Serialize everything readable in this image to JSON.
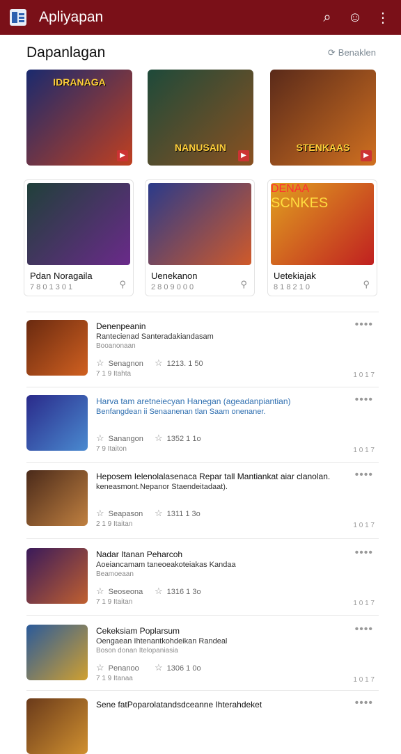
{
  "appbar": {
    "title": "Apliyapan",
    "icons": [
      "menu-logo-icon",
      "search-icon",
      "voice-search-icon",
      "more-vert-icon"
    ]
  },
  "featured": {
    "title": "Dapanlagan",
    "see_all": "Benaklen",
    "tiles": [
      {
        "label": "IDRANAGA",
        "position": "top",
        "colors": [
          "#1a2a6e",
          "#c04020"
        ]
      },
      {
        "label": "NANUSAIN",
        "position": "bottom",
        "colors": [
          "#1e4a3a",
          "#8a5020"
        ]
      },
      {
        "label": "STENKAAS",
        "position": "bottom",
        "colors": [
          "#5a2a1a",
          "#d07020"
        ]
      }
    ],
    "cards": [
      {
        "name": "Pdan Noragaila",
        "meta": "7 8 0 1 3 0 1",
        "colors": [
          "#20403a",
          "#6a2a8a"
        ]
      },
      {
        "name": "Uenekanon",
        "meta": "2 8 0 9 0 0 0",
        "colors": [
          "#2a3a8a",
          "#d05a2a"
        ]
      },
      {
        "name": "Uetekiajak",
        "meta": "8 1 8 2 1 0",
        "colors": [
          "#e0a020",
          "#c02020"
        ],
        "art_label": "SCNKES",
        "art_top": "DENAA"
      }
    ]
  },
  "list": [
    {
      "title": "Denenpeanin",
      "desc": "Rantecienad Santeradakiandasam",
      "sub": "Booanonaan",
      "category": "Senagnon",
      "rating": "1213. 1 50",
      "meta": "7 1   9   Itahta",
      "num": "1 0 1 7",
      "colors": [
        "#6a2a10",
        "#d06020"
      ],
      "title_blue": false
    },
    {
      "title": "Harva tam aretneiecyan Hanegan (ageadanpiantian)",
      "desc": "Benfangdean ii Senaanenan tlan Saam onenaner.",
      "sub": "",
      "category": "Sanangon",
      "rating": "1352 1 1o",
      "meta": "7 9   Itaiton",
      "num": "1 0 1 7",
      "colors": [
        "#2a2a8a",
        "#4a8ad0"
      ],
      "title_blue": true
    },
    {
      "title": "Heposem Ielenolalasenaca Repar tall Mantiankat aiar clanolan.",
      "desc": "keneasmont.Nepanor Staendeitadaat).",
      "sub": "",
      "category": "Seapason",
      "rating": "1311 1 3o",
      "meta": "2 1   9   Itaitan",
      "num": "1 0 1 7",
      "colors": [
        "#4a2a1a",
        "#c08040"
      ],
      "title_blue": false
    },
    {
      "title": "Nadar Itanan Peharcoh",
      "desc": "Aoeiancamam taneoeakoteiakas Kandaa",
      "sub": "Beamoeaan",
      "category": "Seoseona",
      "rating": "1316 1 3o",
      "meta": "7 1   9   Itaitan",
      "num": "1 0 1 7",
      "colors": [
        "#3a1a5a",
        "#c06030"
      ],
      "title_blue": false
    },
    {
      "title": "Cekeksiam Poplarsum",
      "desc": "Oengaean Ihtenantkohdeikan Randeal",
      "sub": "Boson donan Itelopaniasia",
      "category": "Penanoo",
      "rating": "1306 1 0o",
      "meta": "7 1   9   Itanaa",
      "num": "1 0 1 7",
      "colors": [
        "#2a5a9a",
        "#d0a030"
      ],
      "title_blue": false
    },
    {
      "title": "Sene fatPoparolatandsdceanne Ihterahdeket",
      "desc": "",
      "sub": "",
      "category": "",
      "rating": "",
      "meta": "",
      "num": "",
      "colors": [
        "#6a3a1a",
        "#d09030"
      ],
      "title_blue": false
    }
  ]
}
